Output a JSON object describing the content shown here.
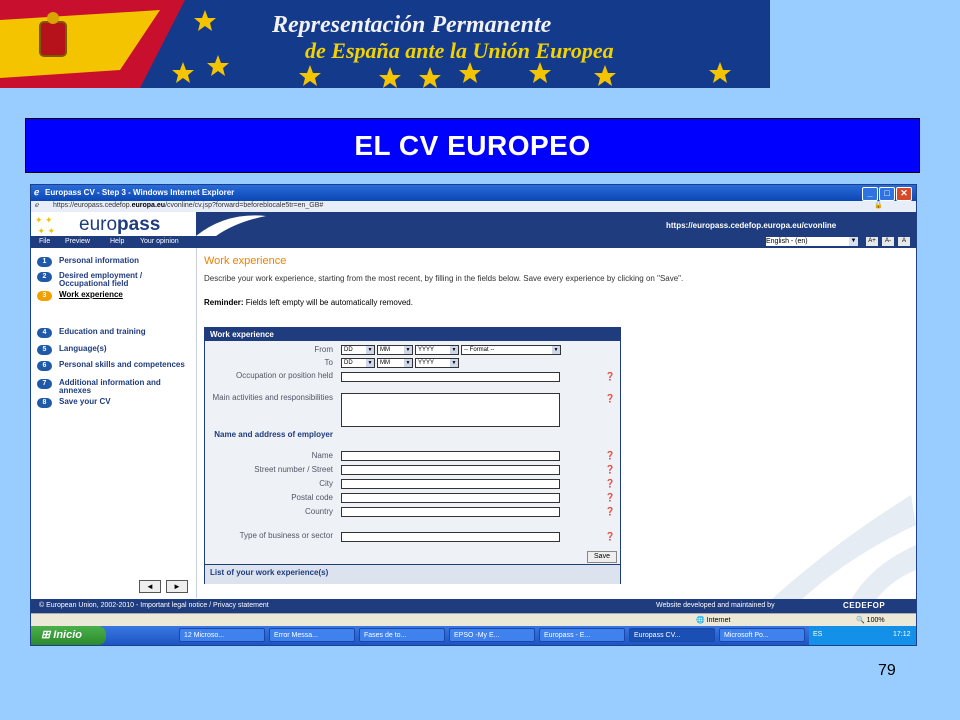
{
  "banner": {
    "line1": "Representación Permanente",
    "line2": "de España ante la Unión Europea"
  },
  "slide": {
    "title": "EL CV EUROPEO",
    "page_number": "79"
  },
  "browser": {
    "window_title": "Europass CV - Step 3 - Windows Internet Explorer",
    "url_pre": "https://europass.cedefop.",
    "url_bold": "europa.eu",
    "url_post": "/cvonline/cv.jsp?forward=beforeblocale5tr=en_GB#"
  },
  "site": {
    "logo_pre": "euro",
    "logo_bold": "pass",
    "url": "https://europass.cedefop.europa.eu/cvonline",
    "menu": [
      "File",
      "Preview",
      "Help",
      "Your opinion"
    ],
    "language": "English - (en)",
    "font_buttons": [
      "A+",
      "A-",
      "A"
    ]
  },
  "sidebar": {
    "steps": [
      {
        "num": "1",
        "label": "Personal information"
      },
      {
        "num": "2",
        "label": "Desired employment / Occupational field"
      },
      {
        "num": "3",
        "label": "Work experience"
      },
      {
        "num": "4",
        "label": "Education and training"
      },
      {
        "num": "5",
        "label": "Language(s)"
      },
      {
        "num": "6",
        "label": "Personal skills and competences"
      },
      {
        "num": "7",
        "label": "Additional information and annexes"
      },
      {
        "num": "8",
        "label": "Save your CV"
      }
    ],
    "prev": "◄",
    "next": "►"
  },
  "main": {
    "heading": "Work experience",
    "description": "Describe your work experience, starting from the most recent, by filling in the fields below. Save every experience by clicking on \"Save\".",
    "reminder_label": "Reminder:",
    "reminder_text": " Fields left empty will be automatically removed."
  },
  "form": {
    "title": "Work experience",
    "from": "From",
    "to": "To",
    "dd": "DD",
    "mm": "MM",
    "yyyy": "YYYY",
    "format": "-- Format --",
    "occupation": "Occupation or position held",
    "activities": "Main activities and responsibilities",
    "employer_heading": "Name and address of employer",
    "name": "Name",
    "street": "Street number / Street",
    "city": "City",
    "postal": "Postal code",
    "country": "Country",
    "business": "Type of business or sector",
    "save": "Save",
    "list": "List of your work experience(s)"
  },
  "footer": {
    "left": "© European Union, 2002-2010 - Important legal notice / Privacy statement",
    "right": "Website developed and maintained by",
    "cedefop": "CEDEFOP"
  },
  "status": {
    "zone": "Internet",
    "zoom": "100%"
  },
  "taskbar": {
    "start": "Inicio",
    "buttons": [
      "12 Microso...",
      "Error Messa...",
      "Fases de to...",
      "EPSO -My E...",
      "Europass - E...",
      "Europass CV...",
      "Microsoft Po..."
    ],
    "lang": "ES",
    "clock": "17:12"
  },
  "colors": {
    "slide_bg": "#99ccff",
    "title_bar": "#0000ff",
    "europass_blue": "#1e3c7e",
    "accent_orange": "#f08000"
  }
}
